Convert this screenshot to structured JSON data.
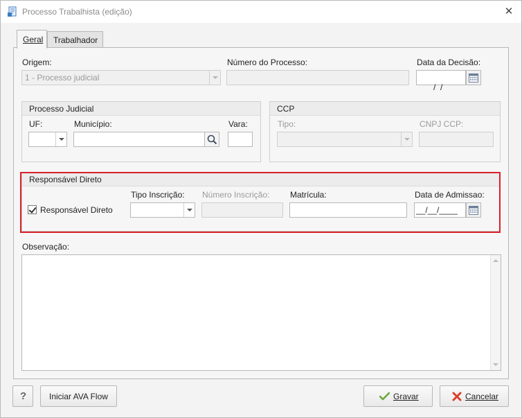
{
  "window": {
    "title": "Processo Trabalhista (edição)",
    "close_glyph": "✕"
  },
  "tabs": [
    {
      "label": "Geral",
      "active": true
    },
    {
      "label": "Trabalhador",
      "active": false
    }
  ],
  "geral": {
    "origem": {
      "label": "Origem:",
      "value": "1 - Processo judicial"
    },
    "numero_processo": {
      "label": "Número do Processo:",
      "value": ""
    },
    "data_decisao": {
      "label": "Data da Decisão:",
      "value": "  /  /"
    }
  },
  "processo_judicial": {
    "title": "Processo Judicial",
    "uf": {
      "label": "UF:",
      "value": ""
    },
    "municipio": {
      "label": "Município:",
      "value": ""
    },
    "vara": {
      "label": "Vara:",
      "value": ""
    }
  },
  "ccp": {
    "title": "CCP",
    "tipo": {
      "label": "Tipo:",
      "value": ""
    },
    "cnpj": {
      "label": "CNPJ CCP:",
      "value": ""
    }
  },
  "responsavel": {
    "title": "Responsável Direto",
    "checkbox_label": "Responsável Direto",
    "checked": true,
    "tipo_inscricao": {
      "label": "Tipo Inscrição:",
      "value": ""
    },
    "numero_inscricao": {
      "label": "Número Inscrição:",
      "value": ""
    },
    "matricula": {
      "label": "Matrícula:",
      "value": ""
    },
    "data_admissao": {
      "label": "Data de Admissao:",
      "value": "__/__/____"
    }
  },
  "observacao": {
    "label": "Observação:",
    "value": ""
  },
  "buttons": {
    "help": "?",
    "iniciar": "Iniciar AVA Flow",
    "gravar": "Gravar",
    "cancelar": "Cancelar"
  },
  "colors": {
    "highlight": "#d9202a",
    "accept": "#6aa83a",
    "cancel": "#d9402a"
  }
}
